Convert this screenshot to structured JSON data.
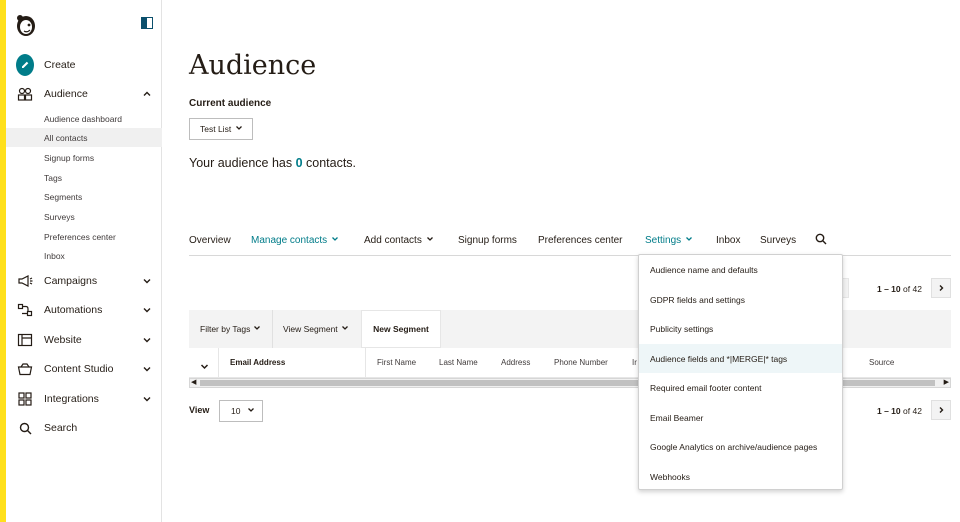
{
  "sidebar": {
    "create": "Create",
    "audience": "Audience",
    "audience_items": [
      "Audience dashboard",
      "All contacts",
      "Signup forms",
      "Tags",
      "Segments",
      "Surveys",
      "Preferences center",
      "Inbox"
    ],
    "campaigns": "Campaigns",
    "automations": "Automations",
    "website": "Website",
    "content_studio": "Content Studio",
    "integrations": "Integrations",
    "search": "Search"
  },
  "header": {
    "title": "Audience",
    "current_label": "Current audience",
    "list_value": "Test List",
    "count_prefix": "Your audience has ",
    "count": "0",
    "count_suffix": " contacts."
  },
  "tabs": {
    "overview": "Overview",
    "manage_contacts": "Manage contacts",
    "add_contacts": "Add contacts",
    "signup_forms": "Signup forms",
    "preferences_center": "Preferences center",
    "settings": "Settings",
    "inbox": "Inbox",
    "surveys": "Surveys"
  },
  "pagination": {
    "range": "1 – 10",
    "of": "of 42"
  },
  "filters": {
    "filter_tags": "Filter by Tags",
    "view_segment": "View Segment",
    "new_segment": "New Segment"
  },
  "table": {
    "columns": [
      "Email Address",
      "First Name",
      "Last Name",
      "Address",
      "Phone Number",
      "Ir",
      "Source"
    ]
  },
  "view": {
    "label": "View",
    "value": "10"
  },
  "settings_menu": {
    "items": [
      "Audience name and defaults",
      "GDPR fields and settings",
      "Publicity settings",
      "Audience fields and *|MERGE|* tags",
      "Required email footer content",
      "Email Beamer",
      "Google Analytics on archive/audience pages",
      "Webhooks"
    ]
  },
  "colors": {
    "accent": "#007c89",
    "brand_yellow": "#ffe01b",
    "text": "#241c15"
  }
}
